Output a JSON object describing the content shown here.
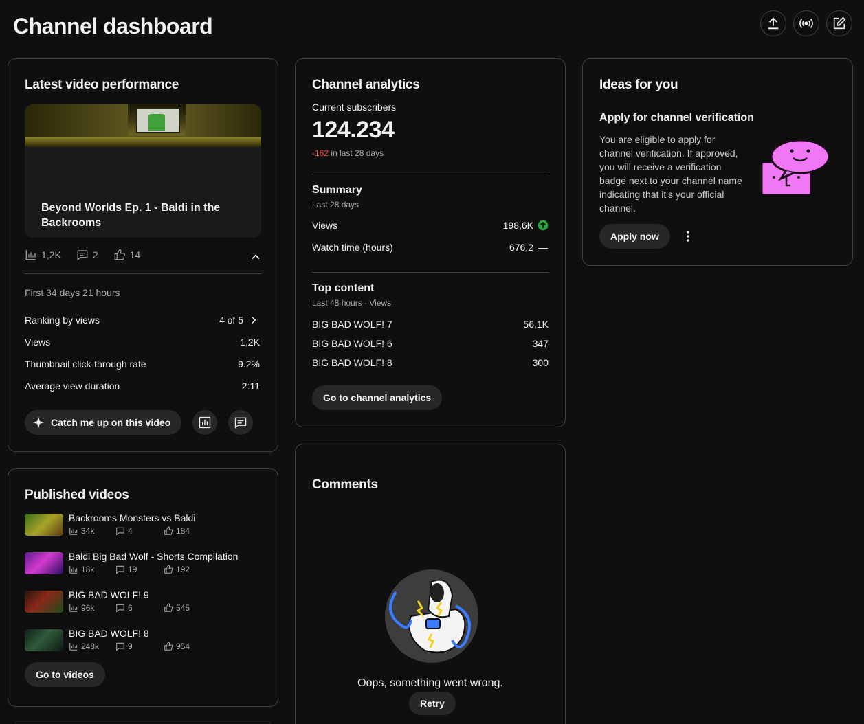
{
  "header": {
    "title": "Channel dashboard",
    "actions": [
      "upload-icon",
      "go-live-icon",
      "create-post-icon"
    ]
  },
  "latest": {
    "title": "Latest video performance",
    "video_title": "Beyond Worlds Ep. 1 - Baldi in the Backrooms",
    "views": "1,2K",
    "comments": "2",
    "likes": "14",
    "period": "First 34 days 21 hours",
    "metrics": [
      {
        "label": "Ranking by views",
        "value": "4 of 5"
      },
      {
        "label": "Views",
        "value": "1,2K"
      },
      {
        "label": "Thumbnail click-through rate",
        "value": "9.2%"
      },
      {
        "label": "Average view duration",
        "value": "2:11"
      }
    ],
    "catch_up_label": "Catch me up on this video"
  },
  "analytics": {
    "title": "Channel analytics",
    "subs_label": "Current subscribers",
    "subs_value": "124.234",
    "subs_change": "-162",
    "subs_change_suffix": " in last 28 days",
    "summary_title": "Summary",
    "summary_period": "Last 28 days",
    "summary": [
      {
        "label": "Views",
        "value": "198,6K",
        "trend": "up"
      },
      {
        "label": "Watch time (hours)",
        "value": "676,2",
        "trend": "flat"
      }
    ],
    "top_title": "Top content",
    "top_period": "Last 48 hours · Views",
    "top": [
      {
        "label": "BIG BAD WOLF! 7",
        "value": "56,1K"
      },
      {
        "label": "BIG BAD WOLF! 6",
        "value": "347"
      },
      {
        "label": "BIG BAD WOLF! 8",
        "value": "300"
      }
    ],
    "button": "Go to channel analytics"
  },
  "ideas": {
    "title": "Ideas for you",
    "heading": "Apply for channel verification",
    "body": "You are eligible to apply for channel verification. If approved, you will receive a verification badge next to your channel name indicating that it's your official channel.",
    "button": "Apply now"
  },
  "published": {
    "title": "Published videos",
    "videos": [
      {
        "title": "Backrooms Monsters vs Baldi",
        "views": "34k",
        "comments": "4",
        "likes": "184"
      },
      {
        "title": "Baldi Big Bad Wolf - Shorts Compilation",
        "views": "18k",
        "comments": "19",
        "likes": "192"
      },
      {
        "title": "BIG BAD WOLF! 9",
        "views": "96k",
        "comments": "6",
        "likes": "545"
      },
      {
        "title": "BIG BAD WOLF! 8",
        "views": "248k",
        "comments": "9",
        "likes": "954"
      }
    ],
    "button": "Go to videos"
  },
  "comments": {
    "title": "Comments",
    "error": "Oops, something went wrong.",
    "retry": "Retry"
  },
  "colors": {
    "background": "#0f0f0f",
    "card_border": "#3f3f3f",
    "pill": "#272727",
    "negative": "#ff4e45",
    "positive": "#2ba640",
    "idea_pink": "#f178f5"
  }
}
